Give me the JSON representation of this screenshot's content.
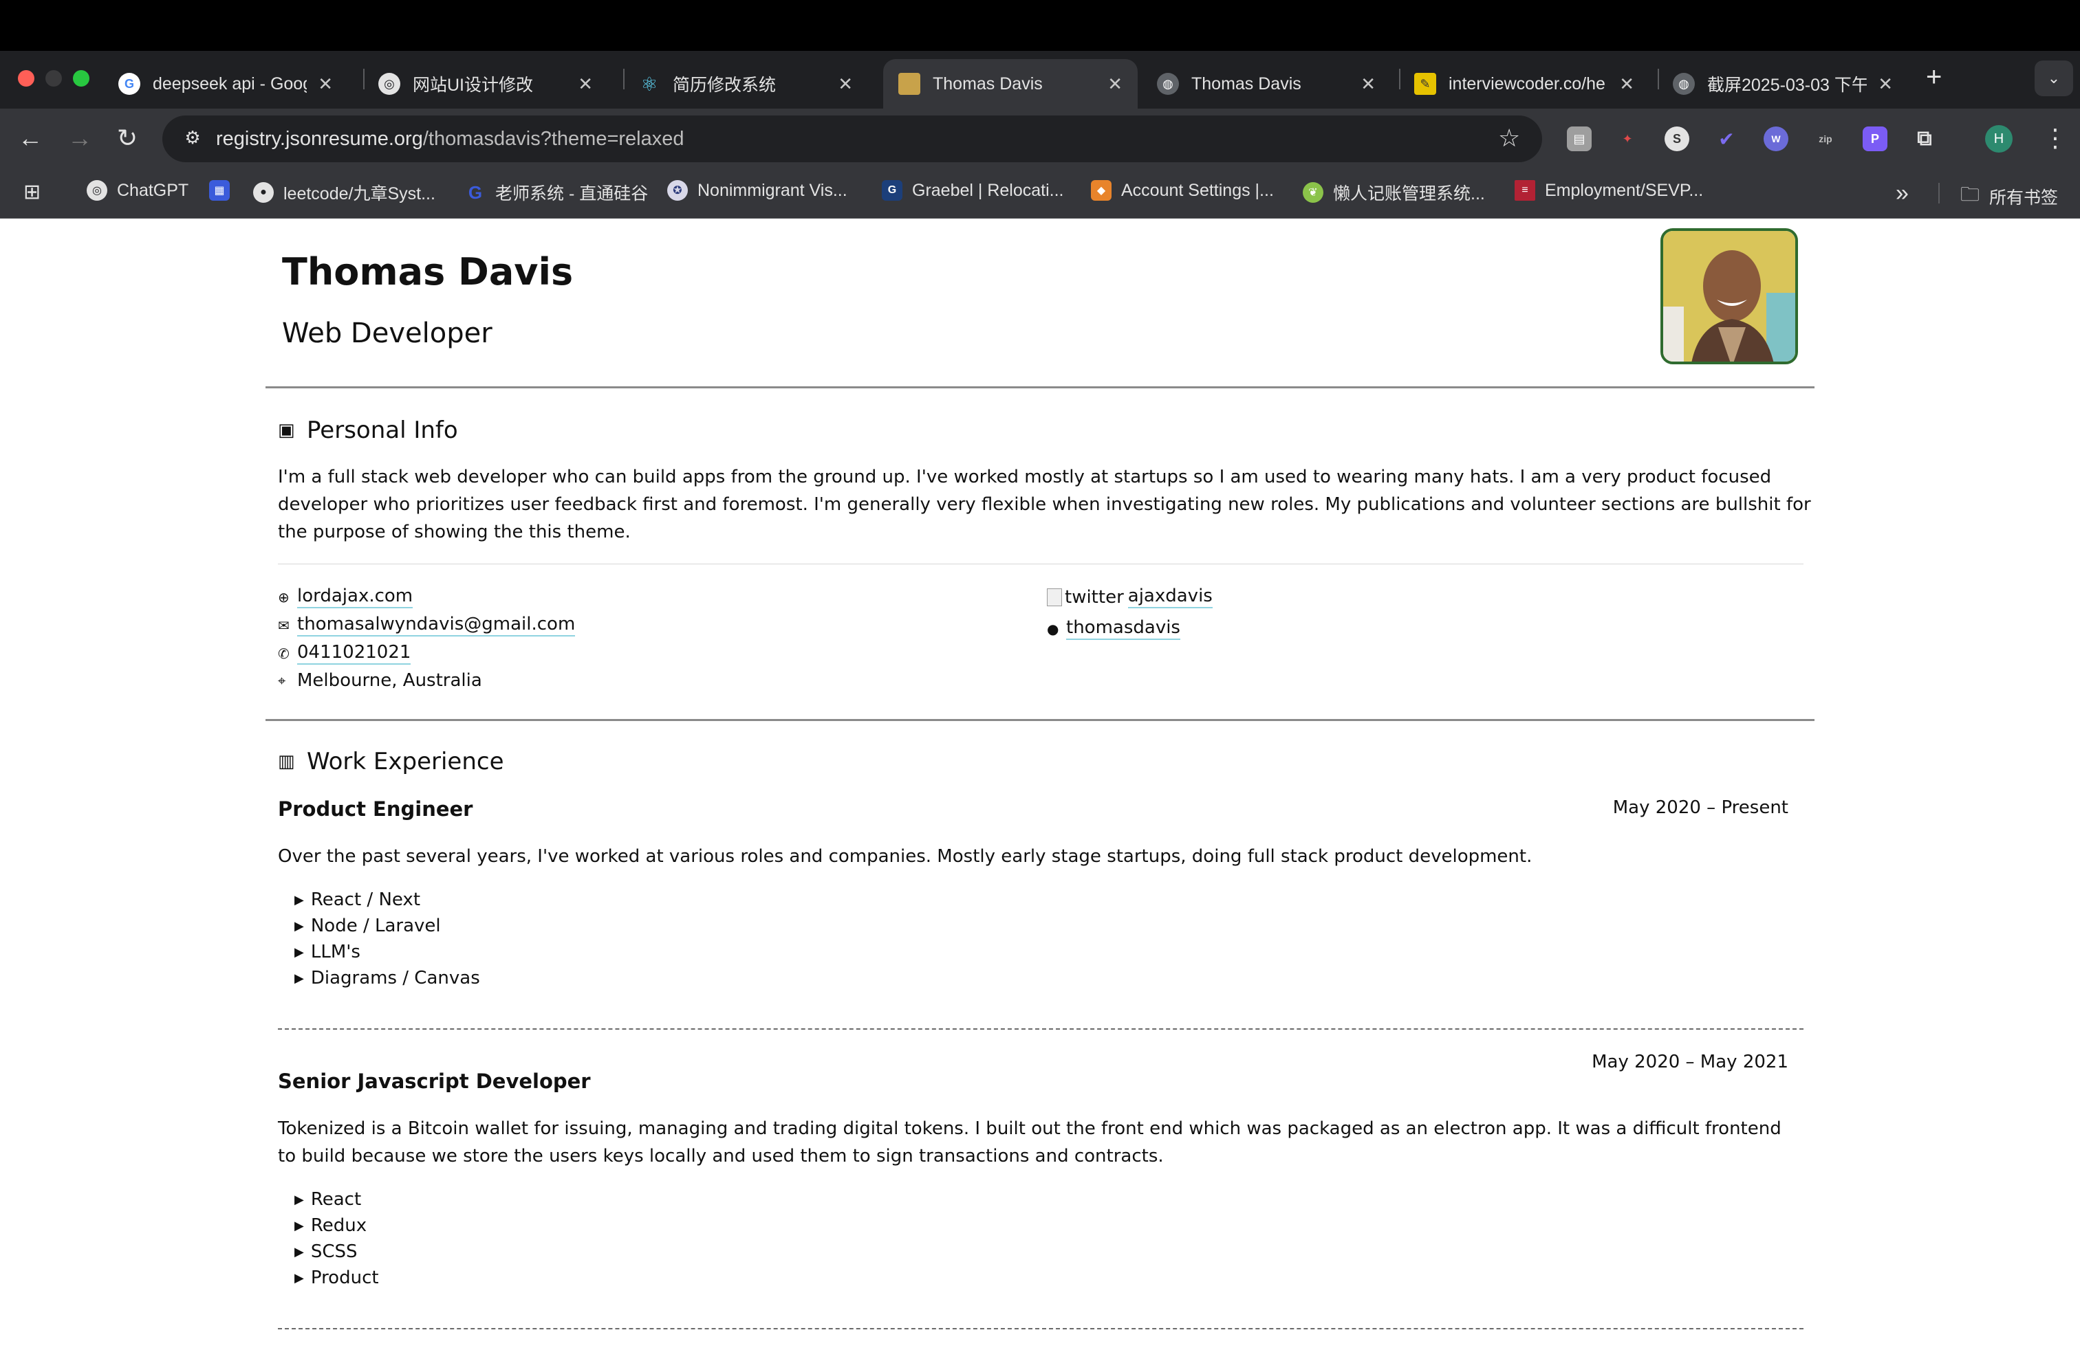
{
  "browser": {
    "tabs": [
      {
        "title": "deepseek api - Goog",
        "icon": "google-icon",
        "color": "#ffffff"
      },
      {
        "title": "网站UI设计修改",
        "icon": "openai-icon",
        "color": "#ffffff"
      },
      {
        "title": "简历修改系统",
        "icon": "react-icon",
        "color": "#61dafb"
      },
      {
        "title": "Thomas Davis",
        "icon": "photo-icon",
        "color": "#c8a24a"
      },
      {
        "title": "Thomas Davis",
        "icon": "globe-icon",
        "color": "#9aa0a6"
      },
      {
        "title": "interviewcoder.co/he",
        "icon": "notes-icon",
        "color": "#e6c200"
      },
      {
        "title": "截屏2025-03-03 下午",
        "icon": "globe-icon",
        "color": "#9aa0a6"
      }
    ],
    "url_host": "registry.jsonresume.org",
    "url_path": "/thomasdavis?theme=relaxed",
    "profile_initial": "H",
    "bookmarks": [
      {
        "label": "ChatGPT",
        "icon": "openai-icon"
      },
      {
        "label": "",
        "icon": "system-design-icon"
      },
      {
        "label": "leetcode/九章Syst...",
        "icon": "github-icon"
      },
      {
        "label": "老师系统 - 直通硅谷",
        "icon": "g-logo-icon"
      },
      {
        "label": "Nonimmigrant Vis...",
        "icon": "seal-icon"
      },
      {
        "label": "Graebel | Relocati...",
        "icon": "g-square-icon"
      },
      {
        "label": "Account Settings |...",
        "icon": "box-icon"
      },
      {
        "label": "懒人记账管理系统...",
        "icon": "leaf-icon"
      },
      {
        "label": "Employment/SEVP...",
        "icon": "us-flag-icon"
      }
    ],
    "all_bookmarks": "所有书签",
    "more_bookmarks": "»"
  },
  "resume": {
    "name": "Thomas Davis",
    "label": "Web Developer",
    "personal_info_title": "Personal Info",
    "summary": "I'm a full stack web developer who can build apps from the ground up. I've worked mostly at startups so I am used to wearing many hats. I am a very product focused developer who prioritizes user feedback first and foremost. I'm generally very flexible when investigating new roles. My publications and volunteer sections are bullshit for the purpose of showing the this theme.",
    "website": "lordajax.com",
    "email": "thomasalwyndavis@gmail.com",
    "phone": "0411021021",
    "location": "Melbourne, Australia",
    "twitter_alt": "twitter",
    "twitter": "ajaxdavis",
    "github": "thomasdavis",
    "work_title": "Work Experience",
    "work": [
      {
        "position": "Product Engineer",
        "date": "May 2020 – Present",
        "summary": "Over the past several years, I've worked at various roles and companies. Mostly early stage startups, doing full stack product development.",
        "highlights": [
          "React / Next",
          "Node / Laravel",
          "LLM's",
          "Diagrams / Canvas"
        ]
      },
      {
        "position": "Senior Javascript Developer",
        "date": "May 2020 – May 2021",
        "summary": "Tokenized is a Bitcoin wallet for issuing, managing and trading digital tokens. I built out the front end which was packaged as an electron app. It was a difficult frontend to build because we store the users keys locally and used them to sign transactions and contracts.",
        "highlights": [
          "React",
          "Redux",
          "SCSS",
          "Product"
        ]
      }
    ]
  }
}
